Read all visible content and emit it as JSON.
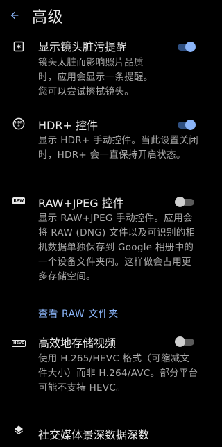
{
  "header": {
    "title": "高级",
    "back_icon": "arrow-back-icon",
    "accent": "#8ab4f8"
  },
  "settings": [
    {
      "icon": "lens-dirty-icon",
      "title": "显示镜头脏污提醒",
      "desc": "镜头太脏而影响照片品质时，应用会显示一条提醒。您可以尝试擦拭镜头。",
      "toggle": true
    },
    {
      "icon": "hdr-plus-icon",
      "title": "HDR+ 控件",
      "desc": "显示 HDR+ 手动控件。当此设置关闭时，HDR+ 会一直保持开启状态。",
      "toggle": true
    },
    {
      "icon": "raw-icon",
      "icon_text": "RAW",
      "title": "RAW+JPEG 控件",
      "desc": "显示 RAW+JPEG 手动控件。应用会将 RAW (DNG) 文件以及可识别的相机数据单独保存到 Google 相册中的一个设备文件夹内。这样做会占用更多存储空间。",
      "link": "查看 RAW 文件夹",
      "toggle": false
    },
    {
      "icon": "hevc-icon",
      "icon_text": "HEVC",
      "title": "高效地存储视频",
      "desc": "使用 H.265/HEVC 格式（可缩减文件大小）而非 H.264/AVC。部分平台可能不支持 HEVC。",
      "toggle": false
    },
    {
      "icon": "layers-icon",
      "title": "社交媒体景深数据深数"
    }
  ]
}
